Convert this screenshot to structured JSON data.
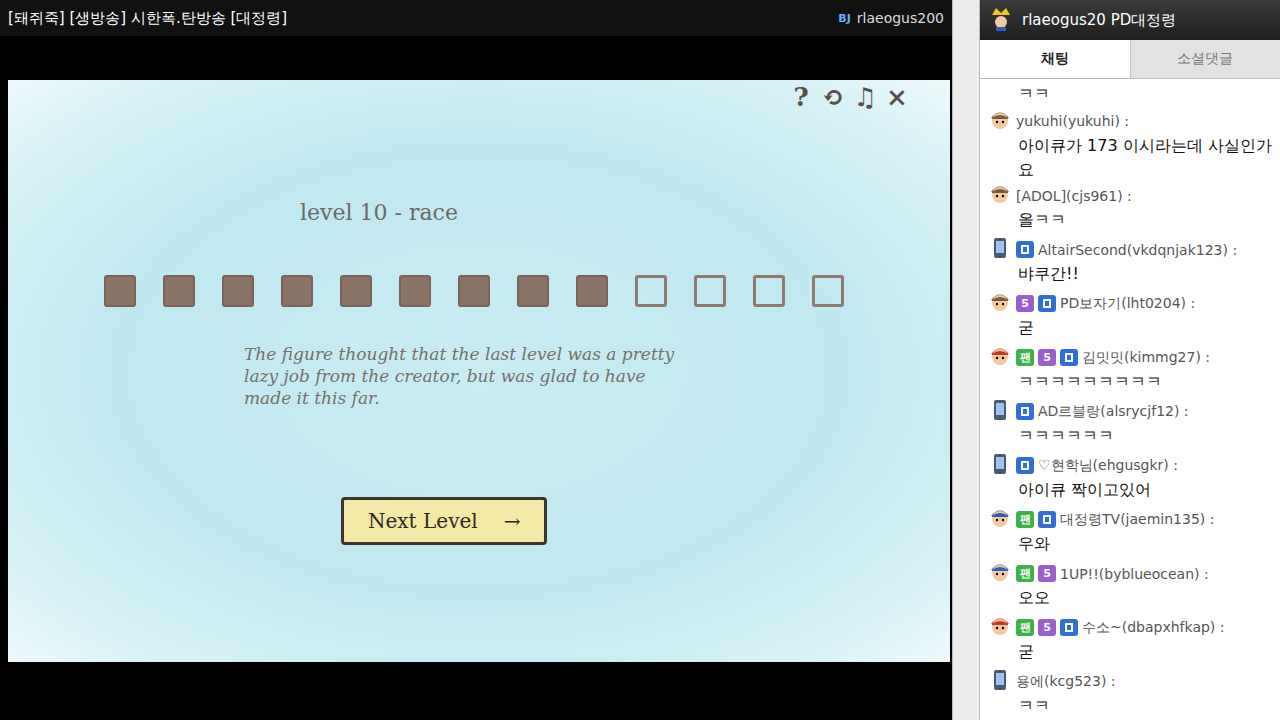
{
  "stream": {
    "title": "[돼쥐죽] [생방송] 시한폭.탄방송 [대정령]",
    "bj_label": "BJ",
    "bj_id": "rlaeogus200"
  },
  "game": {
    "icons": [
      "?",
      "⟲",
      "♫",
      "×"
    ],
    "level_title": "level 10 - race",
    "squares": [
      {
        "filled": true
      },
      {
        "filled": true
      },
      {
        "filled": true
      },
      {
        "filled": true
      },
      {
        "filled": true
      },
      {
        "filled": true
      },
      {
        "filled": true
      },
      {
        "filled": true
      },
      {
        "filled": true
      },
      {
        "filled": false
      },
      {
        "filled": false
      },
      {
        "filled": false
      },
      {
        "filled": false
      }
    ],
    "message": "The figure thought that the last level was a pretty lazy job from the creator, but was glad to have made it this far.",
    "next_button": {
      "label": "Next Level",
      "arrow": "→"
    }
  },
  "chat_header": {
    "user": "rlaeogus20 PD대정령"
  },
  "tabs": [
    {
      "label": "채팅",
      "selected": true
    },
    {
      "label": "소셜댓글",
      "selected": false
    }
  ],
  "messages": [
    {
      "kind": "plain",
      "user": "",
      "text": "ㅋㅋ",
      "fan": false,
      "sub": false,
      "mobile": false
    },
    {
      "kind": "face",
      "avatar": "#7a5a3a",
      "user": "yukuhi(yukuhi) :",
      "text": "아이큐가 173 이시라는데 사실인가요",
      "fan": false,
      "sub": false,
      "mobile": false
    },
    {
      "kind": "face",
      "avatar": "#7a5a3a",
      "user": "[ADOL](cjs961) :",
      "text": "올ㅋㅋ",
      "fan": false,
      "sub": false,
      "mobile": false
    },
    {
      "kind": "phone",
      "user": "AltairSecond(vkdqnjak123) :",
      "text": "뱌쿠간!!",
      "fan": false,
      "sub": false,
      "mobile": true
    },
    {
      "kind": "face",
      "avatar": "#7a5a3a",
      "user": "PD보자기(lht0204) :",
      "text": "굳",
      "fan": false,
      "sub": true,
      "mobile": true
    },
    {
      "kind": "face",
      "avatar": "#c0392b",
      "user": "김밋밋(kimmg27) :",
      "text": "ㅋㅋㅋㅋㅋㅋㅋㅋㅋ",
      "fan": true,
      "sub": true,
      "mobile": true
    },
    {
      "kind": "phone",
      "user": "AD르블랑(alsrycjf12) :",
      "text": "ㅋㅋㅋㅋㅋㅋ",
      "fan": false,
      "sub": false,
      "mobile": true
    },
    {
      "kind": "phone",
      "user": "♡현학님(ehgusgkr) :",
      "text": "아이큐 짝이고있어",
      "fan": false,
      "sub": false,
      "mobile": true
    },
    {
      "kind": "face",
      "avatar": "#2d5fb3",
      "user": "대정령TV(jaemin135) :",
      "text": "우와",
      "fan": true,
      "sub": false,
      "mobile": true
    },
    {
      "kind": "face",
      "avatar": "#2d5fb3",
      "user": "1UP!!(byblueocean) :",
      "text": "오오",
      "fan": true,
      "sub": true,
      "mobile": false
    },
    {
      "kind": "face",
      "avatar": "#c0392b",
      "user": "수소~(dbapxhfkap) :",
      "text": "굳",
      "fan": true,
      "sub": true,
      "mobile": true
    },
    {
      "kind": "phone",
      "user": "용에(kcg523) :",
      "text": "ㅋㅋ",
      "fan": false,
      "sub": false,
      "mobile": false
    }
  ],
  "badges": {
    "fan": "팬",
    "sub": "5"
  }
}
